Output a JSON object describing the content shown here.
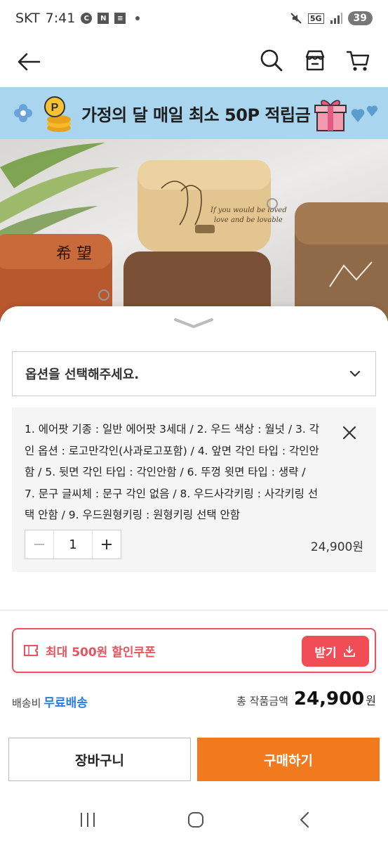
{
  "status_bar": {
    "carrier": "SKT",
    "time": "7:41",
    "network": "5G",
    "battery": "39"
  },
  "nav": {
    "back_icon": "arrow-left-icon",
    "search_icon": "search-icon",
    "store_icon": "store-icon",
    "cart_icon": "cart-icon"
  },
  "banner": {
    "text": "가정의 달 매일 최소 50P 적립금"
  },
  "option_select": {
    "placeholder": "옵션을 선택해주세요."
  },
  "selected_option": {
    "description": "1. 에어팟 기종 : 일반 에어팟 3세대 / 2. 우드 색상 : 월넛 / 3. 각인 옵션 : 로고만각인(사과로고포함) / 4. 앞면 각인 타입 : 각인안함 / 5. 뒷면 각인 타입 : 각인안함 / 6. 뚜껑 윗면 타입 : 생략 / 7. 문구 글씨체 : 문구 각인 없음 / 8. 우드사각키링 : 사각키링 선택 안함 / 9. 우드원형키링 : 원형키링 선택 안함",
    "quantity": "1",
    "price": "24,900원"
  },
  "coupon": {
    "label": "최대 500원 할인쿠폰",
    "button": "받기"
  },
  "shipping": {
    "label": "배송비",
    "value": "무료배송"
  },
  "total": {
    "label": "총 작품금액",
    "value": "24,900",
    "unit": "원"
  },
  "actions": {
    "cart": "장바구니",
    "buy": "구매하기"
  },
  "colors": {
    "accent_orange": "#f07a1d",
    "coupon_red": "#f04d57",
    "link_blue": "#2a7de1",
    "banner_blue": "#a9d6ee"
  }
}
